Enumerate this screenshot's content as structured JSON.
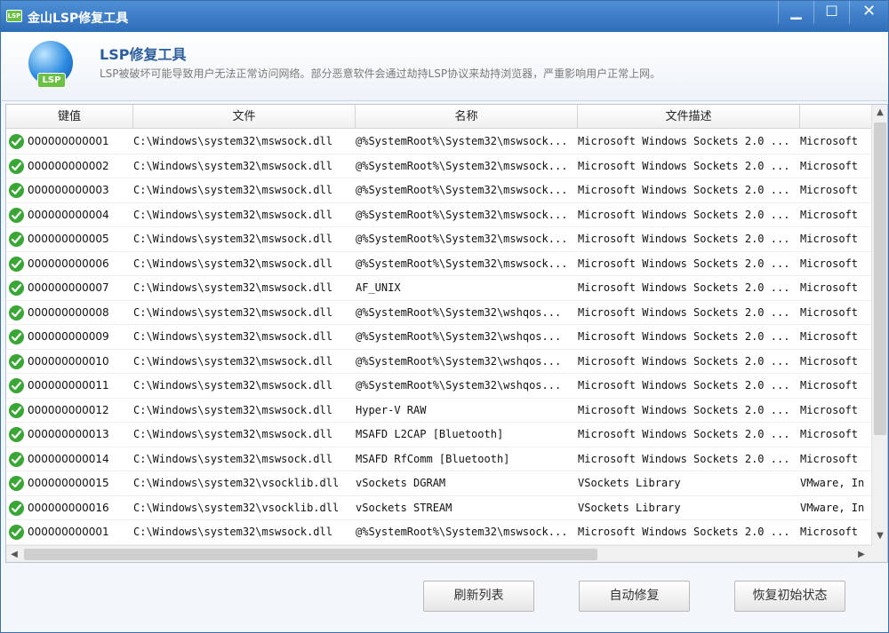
{
  "window": {
    "app_icon_text": "LSP",
    "title": "金山LSP修复工具",
    "minimize_glyph": "▁",
    "maximize_glyph": "☐",
    "close_glyph": "✕"
  },
  "header": {
    "logo_badge": "LSP",
    "title": "LSP修复工具",
    "description": "LSP被破坏可能导致用户无法正常访问网络。部分恶意软件会通过劫持LSP协议来劫持浏览器，严重影响用户正常上网。"
  },
  "columns": [
    "键值",
    "文件",
    "名称",
    "文件描述",
    ""
  ],
  "rows": [
    {
      "key": "000000000001",
      "file": "C:\\Windows\\system32\\mswsock.dll",
      "name": "@%SystemRoot%\\System32\\mswsock...",
      "desc": "Microsoft Windows Sockets 2.0 ...",
      "company": "Microsoft"
    },
    {
      "key": "000000000002",
      "file": "C:\\Windows\\system32\\mswsock.dll",
      "name": "@%SystemRoot%\\System32\\mswsock...",
      "desc": "Microsoft Windows Sockets 2.0 ...",
      "company": "Microsoft"
    },
    {
      "key": "000000000003",
      "file": "C:\\Windows\\system32\\mswsock.dll",
      "name": "@%SystemRoot%\\System32\\mswsock...",
      "desc": "Microsoft Windows Sockets 2.0 ...",
      "company": "Microsoft"
    },
    {
      "key": "000000000004",
      "file": "C:\\Windows\\system32\\mswsock.dll",
      "name": "@%SystemRoot%\\System32\\mswsock...",
      "desc": "Microsoft Windows Sockets 2.0 ...",
      "company": "Microsoft"
    },
    {
      "key": "000000000005",
      "file": "C:\\Windows\\system32\\mswsock.dll",
      "name": "@%SystemRoot%\\System32\\mswsock...",
      "desc": "Microsoft Windows Sockets 2.0 ...",
      "company": "Microsoft"
    },
    {
      "key": "000000000006",
      "file": "C:\\Windows\\system32\\mswsock.dll",
      "name": "@%SystemRoot%\\System32\\mswsock...",
      "desc": "Microsoft Windows Sockets 2.0 ...",
      "company": "Microsoft"
    },
    {
      "key": "000000000007",
      "file": "C:\\Windows\\system32\\mswsock.dll",
      "name": "AF_UNIX",
      "desc": "Microsoft Windows Sockets 2.0 ...",
      "company": "Microsoft"
    },
    {
      "key": "000000000008",
      "file": "C:\\Windows\\system32\\mswsock.dll",
      "name": "@%SystemRoot%\\System32\\wshqos...",
      "desc": "Microsoft Windows Sockets 2.0 ...",
      "company": "Microsoft"
    },
    {
      "key": "000000000009",
      "file": "C:\\Windows\\system32\\mswsock.dll",
      "name": "@%SystemRoot%\\System32\\wshqos...",
      "desc": "Microsoft Windows Sockets 2.0 ...",
      "company": "Microsoft"
    },
    {
      "key": "000000000010",
      "file": "C:\\Windows\\system32\\mswsock.dll",
      "name": "@%SystemRoot%\\System32\\wshqos...",
      "desc": "Microsoft Windows Sockets 2.0 ...",
      "company": "Microsoft"
    },
    {
      "key": "000000000011",
      "file": "C:\\Windows\\system32\\mswsock.dll",
      "name": "@%SystemRoot%\\System32\\wshqos...",
      "desc": "Microsoft Windows Sockets 2.0 ...",
      "company": "Microsoft"
    },
    {
      "key": "000000000012",
      "file": "C:\\Windows\\system32\\mswsock.dll",
      "name": "Hyper-V RAW",
      "desc": "Microsoft Windows Sockets 2.0 ...",
      "company": "Microsoft"
    },
    {
      "key": "000000000013",
      "file": "C:\\Windows\\system32\\mswsock.dll",
      "name": "MSAFD L2CAP [Bluetooth]",
      "desc": "Microsoft Windows Sockets 2.0 ...",
      "company": "Microsoft"
    },
    {
      "key": "000000000014",
      "file": "C:\\Windows\\system32\\mswsock.dll",
      "name": "MSAFD RfComm [Bluetooth]",
      "desc": "Microsoft Windows Sockets 2.0 ...",
      "company": "Microsoft"
    },
    {
      "key": "000000000015",
      "file": "C:\\Windows\\system32\\vsocklib.dll",
      "name": "vSockets DGRAM",
      "desc": "VSockets Library",
      "company": "VMware, In"
    },
    {
      "key": "000000000016",
      "file": "C:\\Windows\\system32\\vsocklib.dll",
      "name": "vSockets STREAM",
      "desc": "VSockets Library",
      "company": "VMware, In"
    },
    {
      "key": "000000000001",
      "file": "C:\\Windows\\system32\\mswsock.dll",
      "name": "@%SystemRoot%\\System32\\mswsock...",
      "desc": "Microsoft Windows Sockets 2.0 ...",
      "company": "Microsoft"
    }
  ],
  "buttons": {
    "refresh": "刷新列表",
    "auto_fix": "自动修复",
    "restore": "恢复初始状态"
  },
  "colors": {
    "titlebar": "#2e6db8",
    "status_ok": "#3aa635",
    "header_title": "#2c5e99"
  }
}
